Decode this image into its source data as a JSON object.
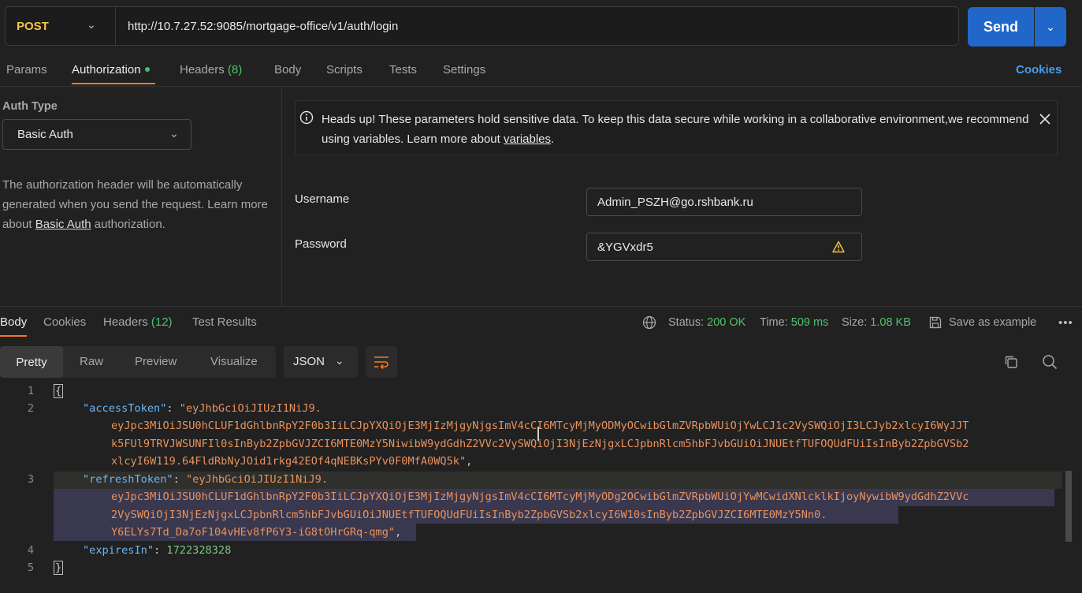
{
  "request": {
    "method": "POST",
    "url": "http://10.7.27.52:9085/mortgage-office/v1/auth/login",
    "send_label": "Send"
  },
  "tabs": {
    "params": "Params",
    "authorization": "Authorization",
    "headers": "Headers",
    "headers_count": "(8)",
    "body": "Body",
    "scripts": "Scripts",
    "tests": "Tests",
    "settings": "Settings",
    "cookies": "Cookies"
  },
  "auth": {
    "type_label": "Auth Type",
    "type_value": "Basic Auth",
    "desc_part1": "The authorization header will be automatically generated when you send the request. Learn more about ",
    "desc_link": "Basic Auth",
    "desc_part2": " authorization.",
    "banner_text": "Heads up! These parameters hold sensitive data. To keep this data secure while working in a collaborative environment,we recommend using variables. Learn more about ",
    "banner_link": "variables",
    "banner_end": ".",
    "username_label": "Username",
    "username_value": "Admin_PSZH@go.rshbank.ru",
    "password_label": "Password",
    "password_value": "&YGVxdr5"
  },
  "response": {
    "tabs": {
      "body": "Body",
      "cookies": "Cookies",
      "headers": "Headers",
      "headers_count": "(12)",
      "test_results": "Test Results"
    },
    "status_label": "Status:",
    "status_value": "200 OK",
    "time_label": "Time:",
    "time_value": "509 ms",
    "size_label": "Size:",
    "size_value": "1.08 KB",
    "save_example": "Save as example",
    "views": [
      "Pretty",
      "Raw",
      "Preview",
      "Visualize"
    ],
    "format": "JSON",
    "line_numbers": [
      "1",
      "2",
      "3",
      "4",
      "5"
    ],
    "code": {
      "open": "{",
      "close": "}",
      "access_key": "\"accessToken\"",
      "access_l1": "\"eyJhbGciOiJIUzI1NiJ9.",
      "access_l2": "eyJpc3MiOiJSU0hCLUF1dGhlbnRpY2F0b3IiLCJpYXQiOjE3MjIzMjgyNjgsImV4cCI6MTcyMjMyODMyOCwibGlmZVRpbWUiOjYwLCJ1c2VySWQiOjI3LCJyb2xlcyI6WyJJT",
      "access_l3": "k5FUl9TRVJWSUNFIl0sInByb2ZpbGVJZCI6MTE0MzY5NiwibW9ydGdhZ2VVc2VySWQiOjI3NjEzNjgxLCJpbnRlcm5hbFJvbGUiOiJNUEtfTUFOQUdFUiIsInByb2ZpbGVSb2",
      "access_l4": "xlcyI6W119.64FldRbNyJOid1rkg42EOf4qNEBKsPYv0F0MfA0WQ5k\"",
      "refresh_key": "\"refreshToken\"",
      "refresh_l1": "\"eyJhbGciOiJIUzI1NiJ9.",
      "refresh_l2": "eyJpc3MiOiJSU0hCLUF1dGhlbnRpY2F0b3IiLCJpYXQiOjE3MjIzMjgyNjgsImV4cCI6MTcyMjMyODg2OCwibGlmZVRpbWUiOjYwMCwidXNlcklkIjoyNywibW9ydGdhZ2VVc",
      "refresh_l3": "2VySWQiOjI3NjEzNjgxLCJpbnRlcm5hbFJvbGUiOiJNUEtfTUFOQUdFUiIsInByb2ZpbGVSb2xlcyI6W10sInByb2ZpbGVJZCI6MTE0MzY5Nn0.",
      "refresh_l4": "Y6ELYs7Td_Da7oF104vHEv8fP6Y3-iG8tOHrGRq-qmg",
      "refresh_end": "\"",
      "expires_key": "\"expiresIn\"",
      "expires_value": "1722328328",
      "colon": ": ",
      "comma": ","
    }
  },
  "colors": {
    "accent": "#f07a2a",
    "send": "#2067c9",
    "link": "#4a9af0",
    "success": "#4fc46b",
    "method": "#f5c543"
  }
}
